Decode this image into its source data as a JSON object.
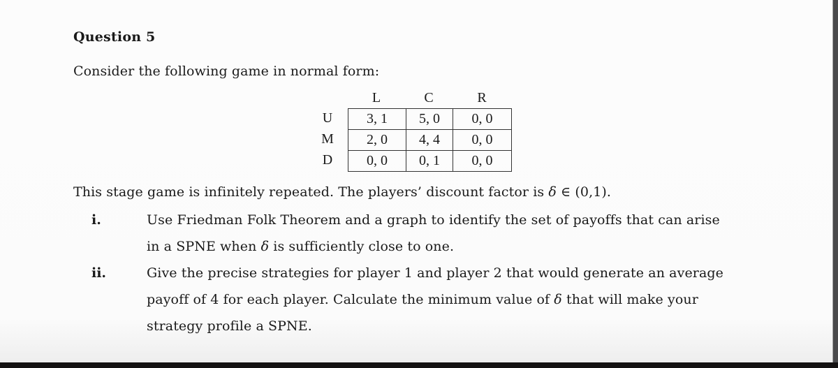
{
  "question": {
    "title": "Question 5",
    "intro": "Consider the following game in normal form:"
  },
  "game": {
    "columns": [
      "L",
      "C",
      "R"
    ],
    "rows": [
      {
        "label": "U",
        "cells": [
          "3, 1",
          "5, 0",
          "0, 0"
        ]
      },
      {
        "label": "M",
        "cells": [
          "2, 0",
          "4, 4",
          "0, 0"
        ]
      },
      {
        "label": "D",
        "cells": [
          "0, 0",
          "0, 1",
          "0, 0"
        ]
      }
    ]
  },
  "statement": {
    "before_delta": "This stage game is infinitely repeated. The players’ discount factor is ",
    "delta": "δ",
    "after_delta": " ∈ (0,1)."
  },
  "parts": [
    {
      "number": "i.",
      "lines": [
        {
          "text": "Use Friedman Folk Theorem and a graph to identify the set of payoffs that can arise"
        },
        {
          "before": "in a SPNE when ",
          "delta": "δ",
          "after": " is sufficiently close to one."
        }
      ]
    },
    {
      "number": "ii.",
      "lines": [
        {
          "text": "Give the precise strategies for player 1 and player 2 that would generate an average"
        },
        {
          "before": "payoff of 4 for each player. Calculate the minimum value of ",
          "delta": "δ",
          "after": " that will make your"
        },
        {
          "text": "strategy profile a SPNE."
        }
      ]
    }
  ]
}
